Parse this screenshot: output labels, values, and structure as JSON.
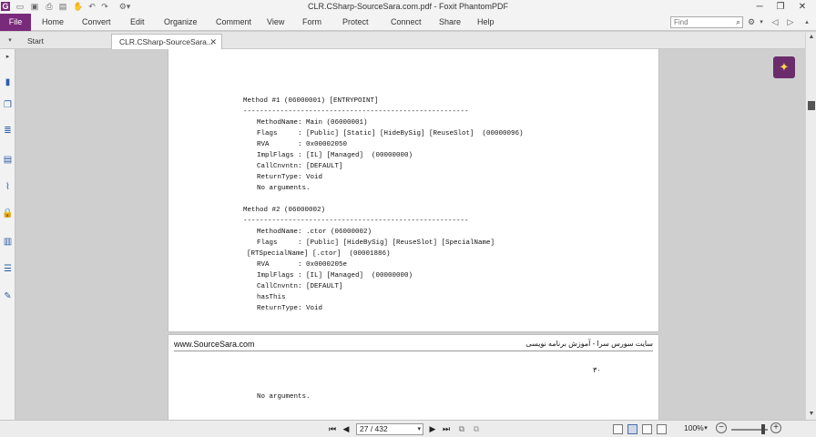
{
  "window": {
    "title": "CLR.CSharp-SourceSara.com.pdf - Foxit PhantomPDF",
    "app_icon": "G"
  },
  "ribbon": {
    "file_label": "File",
    "tabs": [
      "Home",
      "Convert",
      "Edit",
      "Organize",
      "Comment",
      "View",
      "Form",
      "Protect",
      "Connect",
      "Share",
      "Help"
    ],
    "find_placeholder": "Find"
  },
  "doc_tabs": {
    "start_label": "Start",
    "active_label": "CLR.CSharp-SourceSara...",
    "close_glyph": "✕"
  },
  "page1": {
    "lines": [
      {
        "x": 82,
        "text": "Method #1 (06000001) [ENTRYPOINT]"
      },
      {
        "x": 82,
        "text": "-------------------------------------------------------"
      },
      {
        "x": 97,
        "text": "MethodName: Main (06000001)"
      },
      {
        "x": 97,
        "text": "Flags     : [Public] [Static] [HideBySig] [ReuseSlot]  (00000096)"
      },
      {
        "x": 97,
        "text": "RVA       : 0x00002050"
      },
      {
        "x": 97,
        "text": "ImplFlags : [IL] [Managed]  (00000000)"
      },
      {
        "x": 97,
        "text": "CallCnvntn: [DEFAULT]"
      },
      {
        "x": 97,
        "text": "ReturnType: Void"
      },
      {
        "x": 97,
        "text": "No arguments."
      },
      {
        "x": 97,
        "text": ""
      },
      {
        "x": 82,
        "text": "Method #2 (06000002)"
      },
      {
        "x": 82,
        "text": "-------------------------------------------------------"
      },
      {
        "x": 97,
        "text": "MethodName: .ctor (06000002)"
      },
      {
        "x": 97,
        "text": "Flags     : [Public] [HideBySig] [ReuseSlot] [SpecialName]"
      },
      {
        "x": 86,
        "text": "[RTSpecialName] [.ctor]  (00001886)"
      },
      {
        "x": 97,
        "text": "RVA       : 0x0000205e"
      },
      {
        "x": 97,
        "text": "ImplFlags : [IL] [Managed]  (00000000)"
      },
      {
        "x": 97,
        "text": "CallCnvntn: [DEFAULT]"
      },
      {
        "x": 97,
        "text": "hasThis"
      },
      {
        "x": 97,
        "text": "ReturnType: Void"
      }
    ]
  },
  "page2": {
    "header_left": "www.SourceSara.com",
    "header_right": "سایت سورس سرا - آموزش برنامه نویسی",
    "page_number": "۳۰",
    "lines": [
      "No arguments."
    ]
  },
  "status": {
    "page_indicator": "27 / 432",
    "zoom": "100%"
  }
}
